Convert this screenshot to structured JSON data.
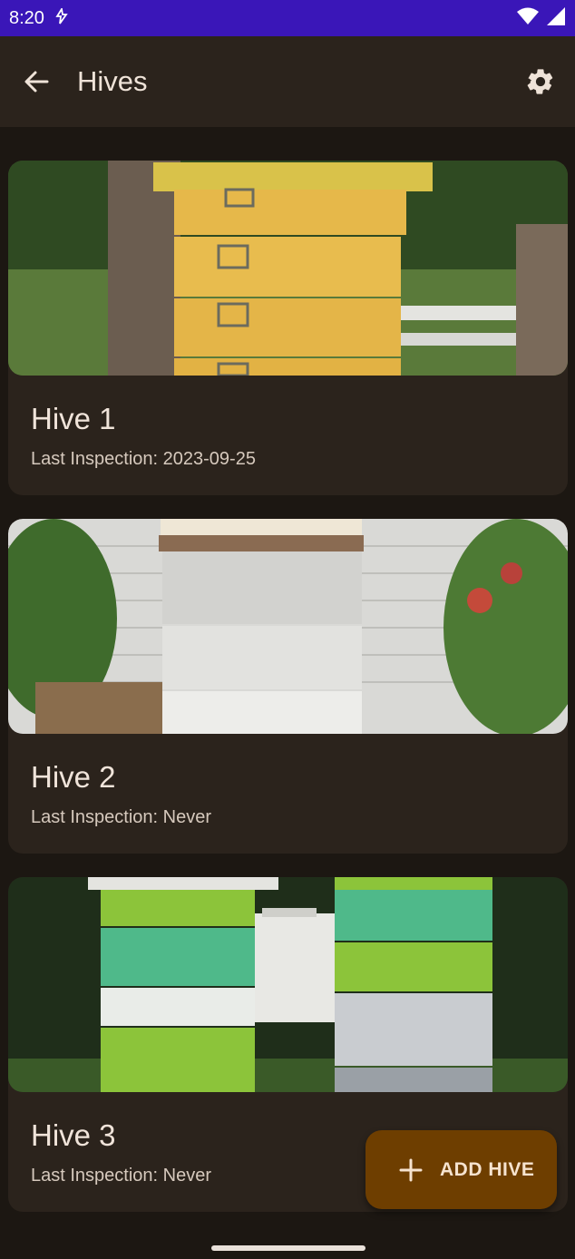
{
  "status_bar": {
    "time": "8:20"
  },
  "app_bar": {
    "title": "Hives"
  },
  "hives": [
    {
      "name": "Hive 1",
      "last_inspection": "Last Inspection: 2023-09-25"
    },
    {
      "name": "Hive 2",
      "last_inspection": "Last Inspection: Never"
    },
    {
      "name": "Hive 3",
      "last_inspection": "Last Inspection: Never"
    }
  ],
  "fab": {
    "label": "ADD HIVE"
  },
  "colors": {
    "status_bar": "#3a16b8",
    "app_bar": "#2b231c",
    "background": "#1c1712",
    "fab": "#6e3e00"
  },
  "icons": [
    "back-arrow-icon",
    "gear-icon",
    "plus-icon",
    "wifi-icon",
    "signal-icon",
    "sync-icon"
  ]
}
